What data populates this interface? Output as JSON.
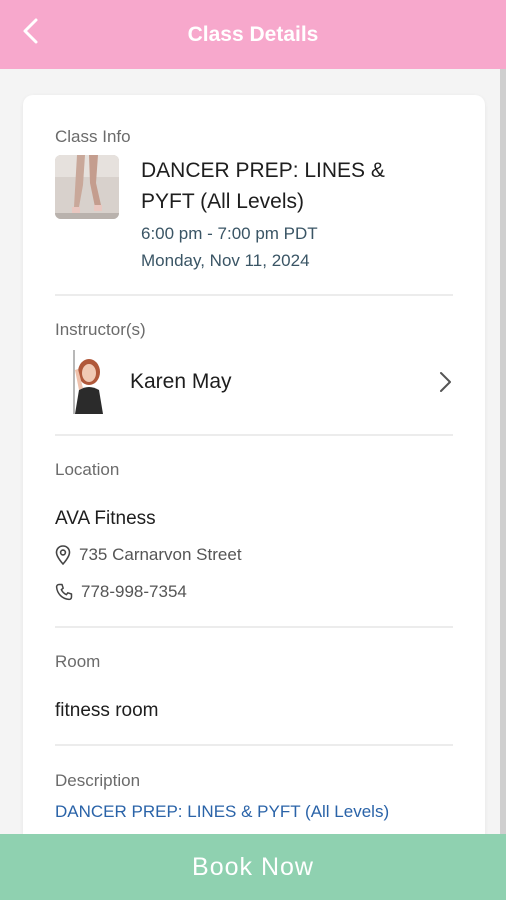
{
  "header": {
    "title": "Class Details"
  },
  "class_info": {
    "section_label": "Class Info",
    "title": "DANCER PREP: LINES & PYFT (All Levels)",
    "time": "6:00 pm - 7:00 pm PDT",
    "date": "Monday, Nov 11, 2024"
  },
  "instructor": {
    "section_label": "Instructor(s)",
    "name": "Karen May"
  },
  "location": {
    "section_label": "Location",
    "name": "AVA Fitness",
    "address": "735 Carnarvon Street",
    "phone": "778-998-7354"
  },
  "room": {
    "section_label": "Room",
    "name": "fitness room"
  },
  "description": {
    "section_label": "Description",
    "text": "DANCER PREP: LINES & PYFT (All Levels)"
  },
  "footer": {
    "book_label": "Book Now"
  },
  "colors": {
    "header_bg": "#f7a8cc",
    "book_bg": "#8fd1b0",
    "link_blue": "#2a63a8",
    "time_text": "#3a5565"
  },
  "icons": {
    "back": "chevron-left-icon",
    "instructor_arrow": "chevron-right-icon",
    "address": "map-pin-icon",
    "phone": "phone-icon"
  }
}
